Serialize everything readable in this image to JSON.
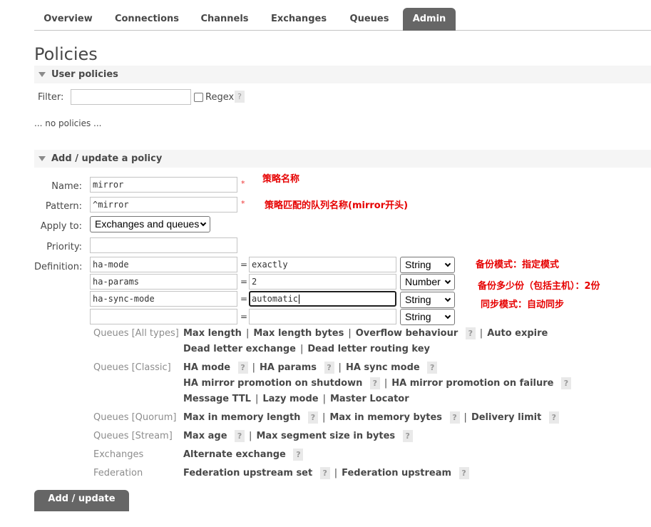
{
  "nav": {
    "tabs": [
      {
        "label": "Overview"
      },
      {
        "label": "Connections"
      },
      {
        "label": "Channels"
      },
      {
        "label": "Exchanges"
      },
      {
        "label": "Queues"
      },
      {
        "label": "Admin"
      }
    ],
    "active_tab": "Admin"
  },
  "page": {
    "title": "Policies"
  },
  "user_policies": {
    "header": "User policies",
    "filter_label": "Filter:",
    "filter_value": "",
    "regex_label": "Regex",
    "help": "?",
    "empty_text": "... no policies ..."
  },
  "form": {
    "header": "Add / update a policy",
    "name_label": "Name:",
    "name_value": "mirror",
    "pattern_label": "Pattern:",
    "pattern_value": "^mirror",
    "required_mark": "*",
    "apply_label": "Apply to:",
    "apply_value": "Exchanges and queues",
    "priority_label": "Priority:",
    "priority_value": "",
    "definition_label": "Definition:",
    "eq": "=",
    "definitions": [
      {
        "key": "ha-mode",
        "value": "exactly",
        "type": "String"
      },
      {
        "key": "ha-params",
        "value": "2",
        "type": "Number"
      },
      {
        "key": "ha-sync-mode",
        "value": "automatic",
        "type": "String"
      },
      {
        "key": "",
        "value": "",
        "type": "String"
      }
    ],
    "submit_label": "Add / update policy"
  },
  "annotations": {
    "name_note": "策略名称",
    "pattern_note": "策略匹配的队列名称(mirror开头)",
    "ha_mode_note": "备份模式：指定模式",
    "ha_params_note": "备份多少份（包括主机）：2份",
    "ha_sync_note": "同步模式：自动同步"
  },
  "hints": {
    "help": "?",
    "sep": "|",
    "queues_all": {
      "label": "Queues [All types]",
      "max_length": "Max length",
      "max_length_bytes": "Max length bytes",
      "overflow": "Overflow behaviour",
      "auto_expire": "Auto expire",
      "dlx": "Dead letter exchange",
      "dlrk": "Dead letter routing key"
    },
    "queues_classic": {
      "label": "Queues [Classic]",
      "ha_mode": "HA mode",
      "ha_params": "HA params",
      "ha_sync_mode": "HA sync mode",
      "ha_promo_shutdown": "HA mirror promotion on shutdown",
      "ha_promo_failure": "HA mirror promotion on failure",
      "msg_ttl": "Message TTL",
      "lazy": "Lazy mode",
      "master_locator": "Master Locator"
    },
    "queues_quorum": {
      "label": "Queues [Quorum]",
      "max_mem_len": "Max in memory length",
      "max_mem_bytes": "Max in memory bytes",
      "delivery_limit": "Delivery limit"
    },
    "queues_stream": {
      "label": "Queues [Stream]",
      "max_age": "Max age",
      "max_segment": "Max segment size in bytes"
    },
    "exchanges": {
      "label": "Exchanges",
      "alt_exchange": "Alternate exchange"
    },
    "federation": {
      "label": "Federation",
      "upstream_set": "Federation upstream set",
      "upstream": "Federation upstream"
    }
  }
}
